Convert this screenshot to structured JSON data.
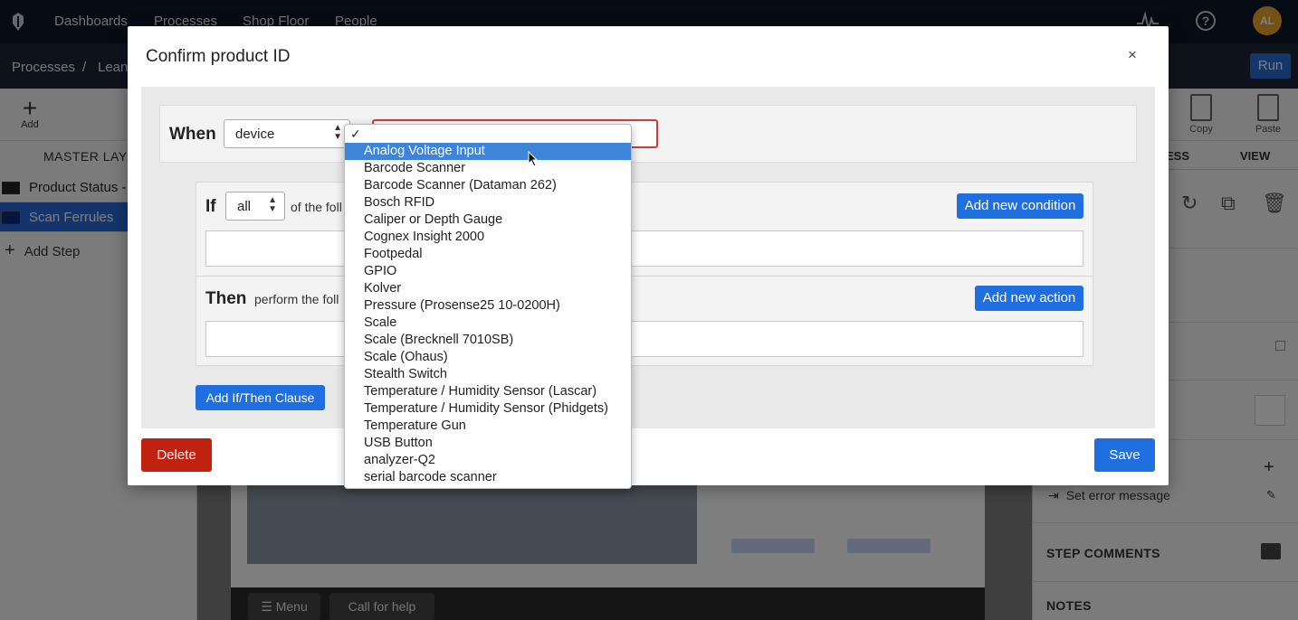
{
  "topnav": {
    "items": [
      "Dashboards",
      "Processes",
      "Shop Floor",
      "People"
    ],
    "avatar": "AL",
    "help": "?"
  },
  "breadcrumb": {
    "root": "Processes",
    "separator": "/",
    "current": "Lean"
  },
  "run_label": "Run",
  "toolbar": {
    "add_label": "Add",
    "copy_label": "Copy",
    "paste_label": "Paste"
  },
  "left_panel": {
    "header": "MASTER LAYO",
    "steps": [
      "Product Status -",
      "Scan Ferrules"
    ],
    "add_step": "Add Step"
  },
  "right_panel": {
    "tabs": [
      "ESS",
      "VIEW"
    ],
    "set_error": "Set error message",
    "step_comments": "STEP COMMENTS",
    "notes": "NOTES"
  },
  "canvas": {
    "menu": "Menu",
    "call_help": "Call for help"
  },
  "modal": {
    "title": "Confirm product ID",
    "close": "×",
    "when_label": "When",
    "when_select": "device",
    "if_label": "If",
    "if_select": "all",
    "if_text": "of the foll",
    "add_condition": "Add new condition",
    "then_label": "Then",
    "then_text": "perform the foll",
    "add_action": "Add new action",
    "add_clause": "Add If/Then Clause",
    "delete": "Delete",
    "save": "Save"
  },
  "dropdown": {
    "check": "✓",
    "selected": "Analog Voltage Input",
    "options": [
      "Analog Voltage Input",
      "Barcode Scanner",
      "Barcode Scanner (Dataman 262)",
      "Bosch RFID",
      "Caliper or Depth Gauge",
      "Cognex Insight 2000",
      "Footpedal",
      "GPIO",
      "Kolver",
      "Pressure (Prosense25 10-0200H)",
      "Scale",
      "Scale (Brecknell 7010SB)",
      "Scale (Ohaus)",
      "Stealth Switch",
      "Temperature / Humidity Sensor (Lascar)",
      "Temperature / Humidity Sensor (Phidgets)",
      "Temperature Gun",
      "USB Button",
      "analyzer-Q2",
      "serial barcode scanner"
    ]
  },
  "colors": {
    "primary": "#1f6fe0",
    "danger": "#c0220f",
    "highlight": "#3d85d8",
    "error_border": "#d13a3a",
    "nav_bg": "#0e1726"
  }
}
